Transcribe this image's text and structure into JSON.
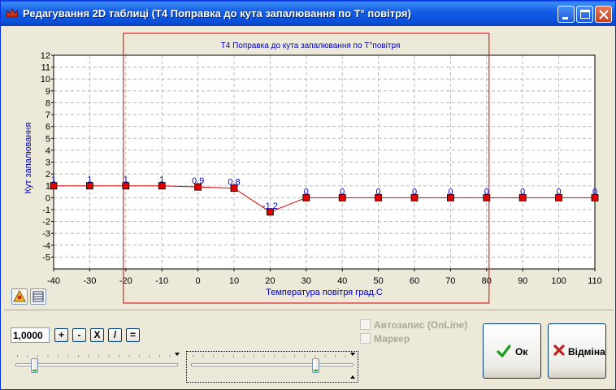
{
  "window": {
    "title": "Редагування 2D таблиці (T4 Поправка до кута запалювання по T° повітря)"
  },
  "chart_data": {
    "type": "line",
    "title": "T4 Поправка до кута запалювання по T°повітря",
    "xlabel": "Температура повітря град.С",
    "ylabel": "Кут запалювання",
    "x": [
      -40,
      -30,
      -20,
      -10,
      0,
      10,
      20,
      30,
      40,
      50,
      60,
      70,
      80,
      90,
      100,
      110
    ],
    "values": [
      1,
      1,
      1,
      1,
      0.9,
      0.8,
      -1.2,
      0,
      0,
      0,
      0,
      0,
      0,
      0,
      0,
      0
    ],
    "point_labels": [
      "1",
      "1",
      "1",
      "1",
      "0.9",
      "0.8",
      "-1.2",
      "0",
      "0",
      "0",
      "0",
      "0",
      "0",
      "0",
      "0",
      "0"
    ],
    "xlim": [
      -40,
      110
    ],
    "ylim": [
      -6,
      12
    ],
    "xticks": [
      -40,
      -30,
      -20,
      -10,
      0,
      10,
      20,
      30,
      40,
      50,
      60,
      70,
      80,
      90,
      100,
      110
    ],
    "yticks": [
      -5,
      -4,
      -3,
      -2,
      -1,
      0,
      1,
      2,
      3,
      4,
      5,
      6,
      7,
      8,
      9,
      10,
      11,
      12
    ],
    "grid": true,
    "selection_x_range": [
      -20,
      80
    ],
    "colors": {
      "line": "#e00000",
      "marker_fill": "#e00000",
      "label": "#0000c0",
      "title": "#0000c0",
      "selection": "#e00000"
    }
  },
  "toolbar": {
    "value": "1,0000",
    "plus_label": "+",
    "minus_label": "-",
    "multiply_label": "X",
    "divide_label": "/",
    "equals_label": "="
  },
  "sliders": {
    "left_position": 0.1,
    "right_position": 0.78
  },
  "options": {
    "autosave_label": "Автозапис (OnLine)",
    "autosave_checked": false,
    "marker_label": "Маркер",
    "marker_checked": false
  },
  "buttons": {
    "ok_label": "Ок",
    "cancel_label": "Відміна"
  },
  "icons": {
    "app": "crown-icon",
    "chart_settings": "chart-settings-icon",
    "table_view": "table-icon"
  }
}
